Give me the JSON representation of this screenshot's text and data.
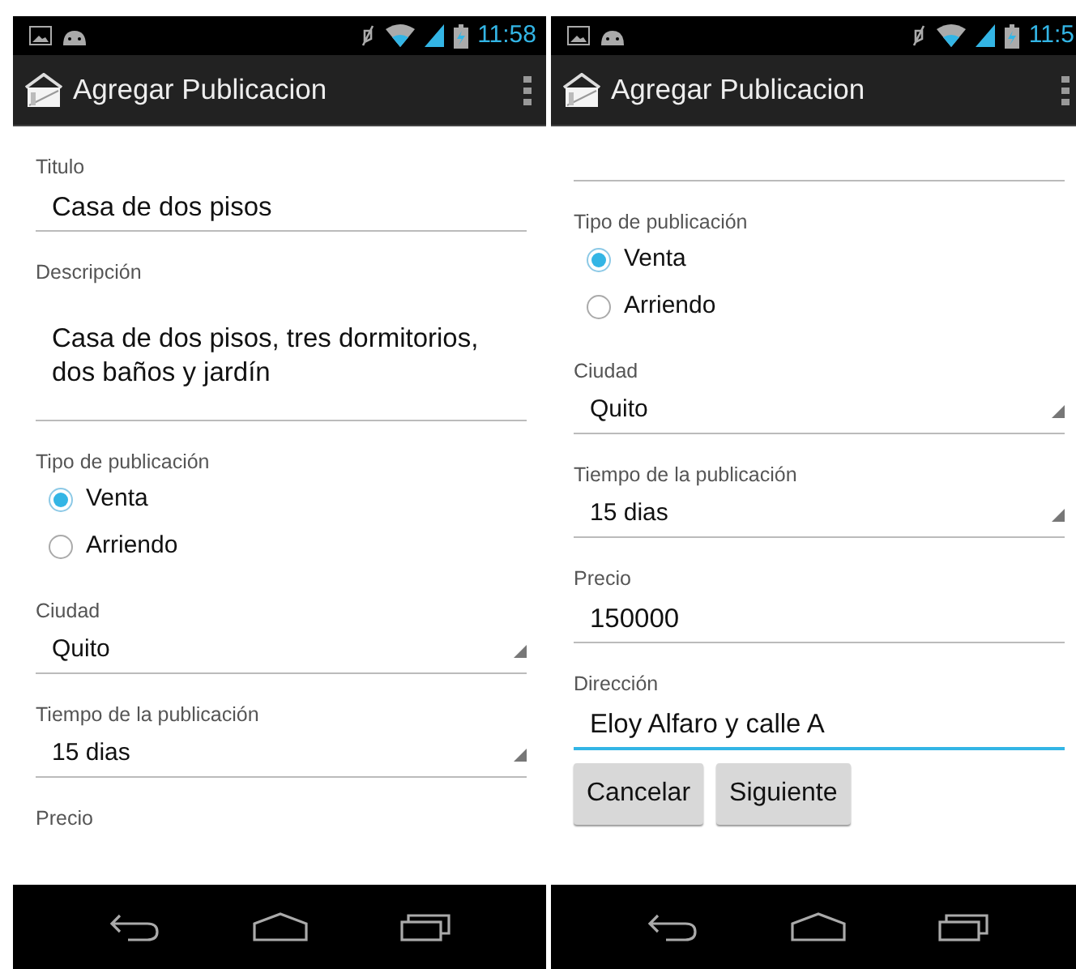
{
  "phones": [
    {
      "status_time": "11:58",
      "title": "Agregar Publicacion",
      "fields": [
        {
          "kind": "text",
          "label": "Titulo",
          "value": "Casa de dos pisos",
          "focused": false
        },
        {
          "kind": "textarea",
          "label": "Descripción",
          "value": "Casa de dos pisos, tres dormitorios, dos baños y jardín",
          "focused": false
        },
        {
          "kind": "radio",
          "label": "Tipo de publicación",
          "options": [
            {
              "label": "Venta",
              "selected": true
            },
            {
              "label": "Arriendo",
              "selected": false
            }
          ]
        },
        {
          "kind": "spinner",
          "label": "Ciudad",
          "value": "Quito"
        },
        {
          "kind": "spinner",
          "label": "Tiempo de la publicación",
          "value": "15 dias"
        },
        {
          "kind": "label",
          "label": "Precio"
        }
      ]
    },
    {
      "status_time": "11:5",
      "title": "Agregar Publicacion",
      "fields": [
        {
          "kind": "edge"
        },
        {
          "kind": "radio",
          "label": "Tipo de publicación",
          "options": [
            {
              "label": "Venta",
              "selected": true
            },
            {
              "label": "Arriendo",
              "selected": false
            }
          ]
        },
        {
          "kind": "spinner",
          "label": "Ciudad",
          "value": "Quito"
        },
        {
          "kind": "spinner",
          "label": "Tiempo de la publicación",
          "value": "15 dias"
        },
        {
          "kind": "text",
          "label": "Precio",
          "value": "150000",
          "focused": false
        },
        {
          "kind": "text",
          "label": "Dirección",
          "value": "Eloy Alfaro y calle A",
          "focused": true
        },
        {
          "kind": "buttons",
          "buttons": [
            "Cancelar",
            "Siguiente"
          ]
        }
      ]
    }
  ]
}
